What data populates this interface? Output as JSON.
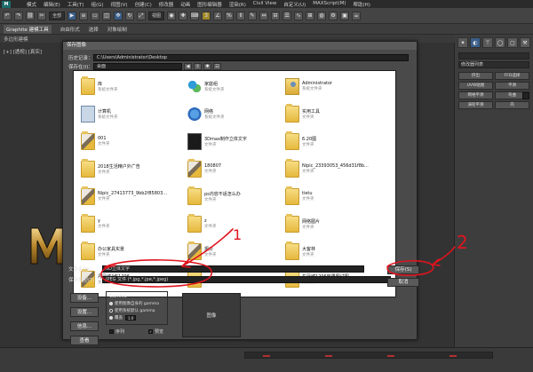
{
  "app": {
    "menu": [
      "模式",
      "编辑(E)",
      "工具(T)",
      "组(G)",
      "视图(V)",
      "创建(C)",
      "修改器",
      "动画",
      "图形编辑器",
      "渲染(R)",
      "Civil View",
      "自定义(U)",
      "MAXScript(M)",
      "帮助(H)"
    ],
    "toolbar_select_label": "全部",
    "toolbar_view_label": "视图",
    "ribbon_tabs": [
      "Graphite 建模工具",
      "自由形式",
      "选择",
      "对象绘制"
    ],
    "ribbon_subtitle": "多边形建模",
    "viewport_label": "[+] [透视] [真实]",
    "command_panel": {
      "field1": "",
      "modifier_list": "修改器列表",
      "buttons": [
        "挤出",
        "FFD选择",
        "UVW贴图",
        "平滑",
        "网格平滑",
        "弯曲",
        "涡轮平滑",
        "壳"
      ]
    }
  },
  "dialog": {
    "title": "保存图像",
    "history_label": "历史记录：",
    "history_value": "C:\\Users\\Administrator\\Desktop",
    "save_in_label": "保存在(I)：",
    "save_in_value": "桌面",
    "nav_icons": [
      "back-icon",
      "up-folder-icon",
      "new-folder-icon",
      "view-menu-icon"
    ],
    "files": [
      {
        "name": "库",
        "type": "系统文件夹",
        "icon": "folder"
      },
      {
        "name": "家庭组",
        "type": "系统文件夹",
        "icon": "homegroup"
      },
      {
        "name": "Administrator",
        "type": "系统文件夹",
        "icon": "user"
      },
      {
        "name": "计算机",
        "type": "系统文件夹",
        "icon": "computer"
      },
      {
        "name": "网络",
        "type": "系统文件夹",
        "icon": "network"
      },
      {
        "name": "实用工具",
        "type": "文件夹",
        "icon": "folder"
      },
      {
        "name": "001",
        "type": "文件夹",
        "icon": "folder"
      },
      {
        "name": "3Dmax制作立体文字",
        "type": "文件夹",
        "icon": "darkthumb"
      },
      {
        "name": "6.20图",
        "type": "文件夹",
        "icon": "folder"
      },
      {
        "name": "2018生活精户外广告",
        "type": "文件夹",
        "icon": "folder"
      },
      {
        "name": "180807",
        "type": "文件夹",
        "icon": "folder"
      },
      {
        "name": "Nipic_23393053_456d31f8b...",
        "type": "文件夹",
        "icon": "folder"
      },
      {
        "name": "Nipic_27413773_9bb2f85803...",
        "type": "文件夹",
        "icon": "folder"
      },
      {
        "name": "ps内容不适怎么办",
        "type": "文件夹",
        "icon": "folder"
      },
      {
        "name": "tietu",
        "type": "文件夹",
        "icon": "folder"
      },
      {
        "name": "y",
        "type": "文件夹",
        "icon": "folder"
      },
      {
        "name": "z",
        "type": "文件夹",
        "icon": "folder"
      },
      {
        "name": "网络图片",
        "type": "文件夹",
        "icon": "folder"
      },
      {
        "name": "办公家具实景",
        "type": "文件夹",
        "icon": "folder"
      },
      {
        "name": "报价",
        "type": "文件夹",
        "icon": "folder"
      },
      {
        "name": "大客林",
        "type": "文件夹",
        "icon": "folder"
      },
      {
        "name": "丹凤城4栋1206",
        "type": "文件夹",
        "icon": "folder"
      },
      {
        "name": "",
        "type": "",
        "icon": "folder"
      },
      {
        "name": "东凤城1206效果图试图",
        "type": "文件夹",
        "icon": "folder"
      }
    ],
    "filename_label": "文件名(N)：",
    "filename_value": "3D立体文字",
    "filetype_label": "保存类型(T)：",
    "filetype_value": "JPEG 文件 (*.jpg,*.jpe,*.jpeg)",
    "save_button": "保存(S)",
    "cancel_button": "取消",
    "left_buttons": [
      "设备...",
      "设置...",
      "信息...",
      "查看"
    ],
    "gamma": {
      "title": "Gamma",
      "options": [
        "使用图像自身的 gamma",
        "使用系统默认 gamma",
        "覆盖"
      ],
      "selected": 1,
      "override_value": "1.0"
    },
    "image_preview_label": "图像",
    "sequence_label": "序列",
    "preview_label": "预览",
    "sequence_checked": false,
    "preview_checked": true
  },
  "annotations": {
    "marker1": "1",
    "marker2": "2",
    "color": "#e0141e"
  }
}
